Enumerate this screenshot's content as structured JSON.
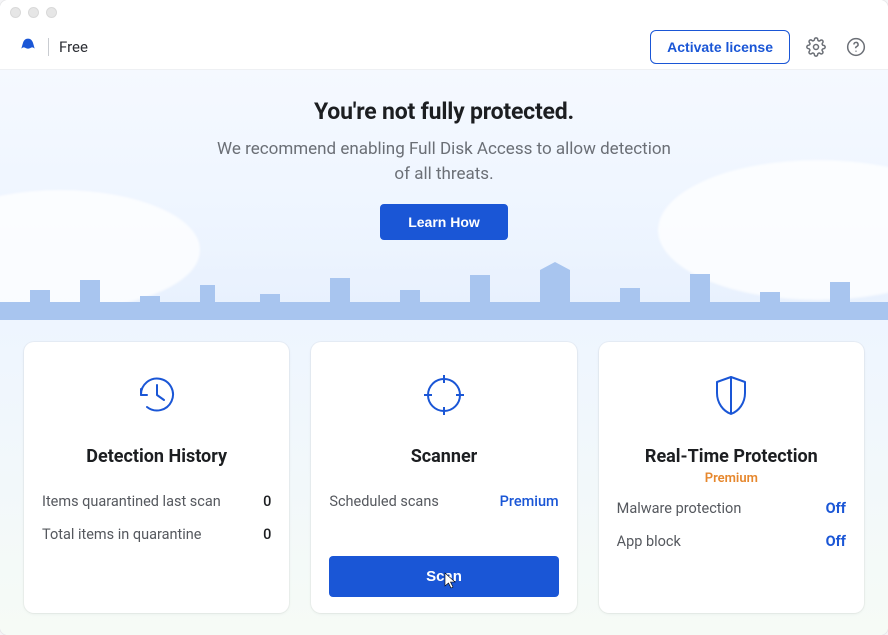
{
  "header": {
    "tier": "Free",
    "activate_label": "Activate license"
  },
  "hero": {
    "title": "You're not fully protected.",
    "subtitle_line1": "We recommend enabling Full Disk Access to allow detection",
    "subtitle_line2": "of all threats.",
    "learn_label": "Learn How"
  },
  "cards": {
    "history": {
      "title": "Detection History",
      "rows": [
        {
          "label": "Items quarantined last scan",
          "value": "0"
        },
        {
          "label": "Total items in quarantine",
          "value": "0"
        }
      ]
    },
    "scanner": {
      "title": "Scanner",
      "rows": [
        {
          "label": "Scheduled scans",
          "value": "Premium"
        }
      ],
      "scan_label": "Scan"
    },
    "realtime": {
      "title": "Real-Time Protection",
      "subtitle": "Premium",
      "rows": [
        {
          "label": "Malware protection",
          "value": "Off"
        },
        {
          "label": "App block",
          "value": "Off"
        }
      ]
    }
  }
}
